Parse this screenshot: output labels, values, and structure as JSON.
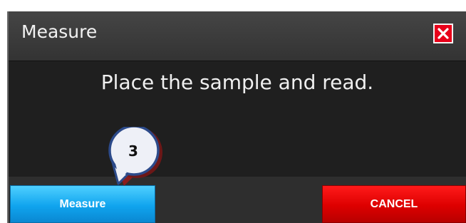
{
  "dialog": {
    "title": "Measure",
    "message": "Place the sample and read.",
    "buttons": {
      "measure_label": "Measure",
      "cancel_label": "CANCEL"
    },
    "close_icon": "close-icon"
  },
  "callout": {
    "step_number": "3"
  },
  "colors": {
    "dialog_background": "#1f1f1f",
    "titlebar": "#3c3c3c",
    "measure_button": "#10a4ee",
    "cancel_button": "#dd0000",
    "close_button": "#e8001a",
    "callout_fill": "#eef0f7",
    "callout_border": "#2c4a8a"
  }
}
